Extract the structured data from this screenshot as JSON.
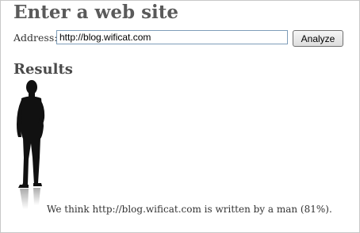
{
  "page": {
    "title": "Enter a web site"
  },
  "form": {
    "address_label": "Address:",
    "address_value": "http://blog.wificat.com",
    "analyze_label": "Analyze"
  },
  "results": {
    "heading": "Results",
    "verdict": "We think http://blog.wificat.com is written by a man (81%).",
    "image": "man-silhouette-icon"
  },
  "colors": {
    "title": "#5a5a5a",
    "silhouette": "#111111"
  }
}
